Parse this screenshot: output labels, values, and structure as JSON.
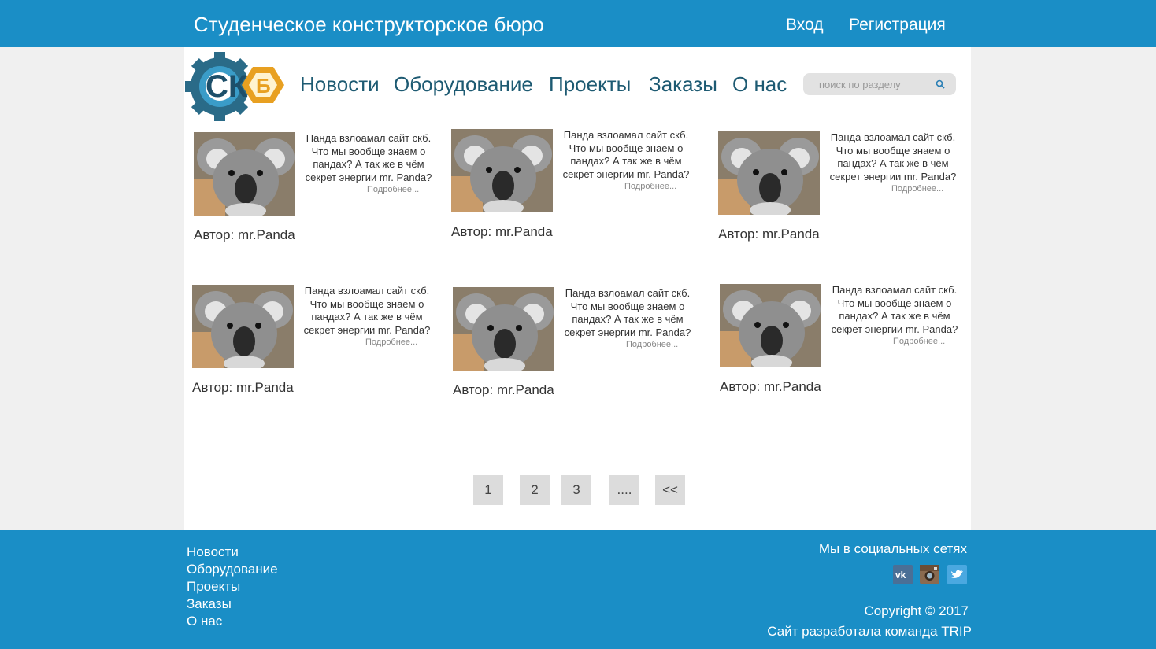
{
  "header": {
    "site_title": "Студенческое конструкторское бюро",
    "login": "Вход",
    "register": "Регистрация"
  },
  "nav": {
    "items": [
      "Новости",
      "Оборудование",
      "Проекты",
      "Заказы",
      "О нас"
    ]
  },
  "search": {
    "placeholder": "поиск по разделу"
  },
  "cards": [
    {
      "teaser": "Панда взлоамал сайт скб. Что мы вообще знаем о пандах? А так же в чём секрет энергии mr. Panda?",
      "more": "Подробнее...",
      "author": "Автор: mr.Panda"
    },
    {
      "teaser": "Панда взлоамал сайт скб. Что мы вообще знаем о пандах? А так же в чём секрет энергии mr. Panda?",
      "more": "Подробнее...",
      "author": "Автор: mr.Panda"
    },
    {
      "teaser": "Панда взлоамал сайт скб. Что мы вообще знаем о пандах? А так же в чём секрет энергии mr. Panda?",
      "more": "Подробнее...",
      "author": "Автор: mr.Panda"
    },
    {
      "teaser": "Панда взлоамал сайт скб. Что мы вообще знаем о пандах? А так же в чём секрет энергии mr. Panda?",
      "more": "Подробнее...",
      "author": "Автор: mr.Panda"
    },
    {
      "teaser": "Панда взлоамал сайт скб. Что мы вообще знаем о пандах? А так же в чём секрет энергии mr. Panda?",
      "more": "Подробнее...",
      "author": "Автор: mr.Panda"
    },
    {
      "teaser": "Панда взлоамал сайт скб. Что мы вообще знаем о пандах? А так же в чём секрет энергии mr. Panda?",
      "more": "Подробнее...",
      "author": "Автор: mr.Panda"
    }
  ],
  "pagination": [
    "1",
    "2",
    "3",
    "....",
    "<<"
  ],
  "footer": {
    "nav": [
      "Новости",
      "Оборудование",
      "Проекты",
      "Заказы",
      "О нас"
    ],
    "social_label": "Мы в социальных сетях",
    "social_icons": [
      "vk-icon",
      "instagram-icon",
      "twitter-icon"
    ],
    "copyright": "Copyright © 2017",
    "credit": "Сайт разработала команда TRIP"
  },
  "colors": {
    "header_bg": "#1a8ec6",
    "nav_text": "#1d5a72",
    "page_bg": "#ffffff",
    "side_bg": "#f0f0f0"
  }
}
